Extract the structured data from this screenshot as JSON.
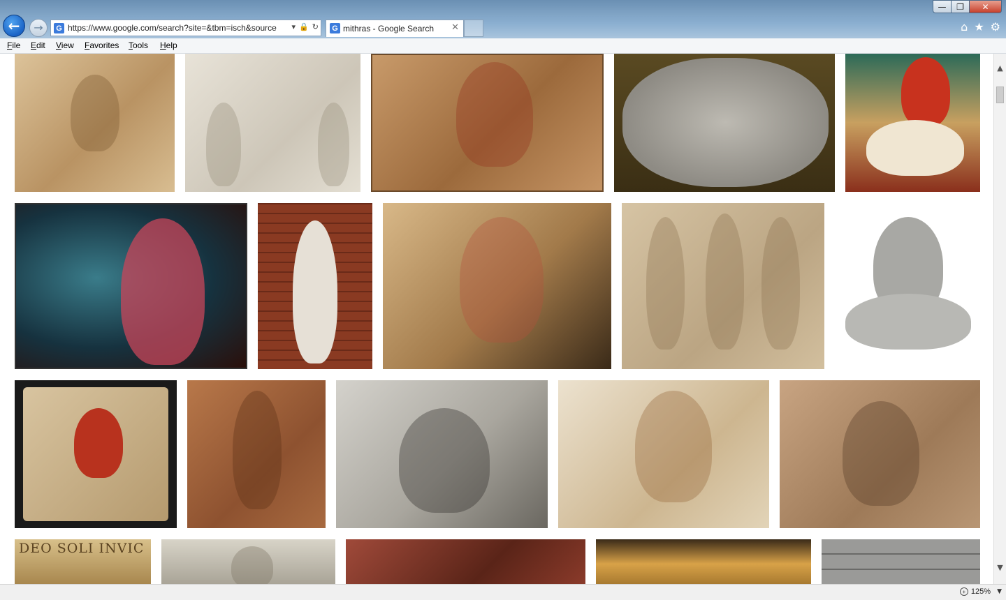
{
  "browser": {
    "address_url": "https://www.google.com/search?site=&tbm=isch&source",
    "tab_title": "mithras - Google Search",
    "tab_favicon": "G",
    "back_glyph": "←",
    "forward_glyph": "→",
    "tab_close_glyph": "✕",
    "window_controls": {
      "minimize": "—",
      "maximize": "❐",
      "close": "✕"
    },
    "toolbar_icons": {
      "home": "⌂",
      "favorites": "★",
      "settings": "⚙"
    }
  },
  "menu": {
    "items": [
      {
        "label": "File"
      },
      {
        "label": "Edit"
      },
      {
        "label": "View"
      },
      {
        "label": "Favorites"
      },
      {
        "label": "Tools"
      },
      {
        "label": "Help"
      }
    ]
  },
  "image_grid": {
    "rows": [
      [
        {
          "alt": "Mithras tauroctony relief, cream stone"
        },
        {
          "alt": "Mithras relief with torchbearers, white marble"
        },
        {
          "alt": "Mithras slaying bull, painted terracotta relief"
        },
        {
          "alt": "Mithras tauroctony sculpture, grey marble"
        },
        {
          "alt": "Mithras fresco, red cloak and white bull"
        }
      ],
      [
        {
          "alt": "Mithras fresco with starry blue cloak",
          "selected": true
        },
        {
          "alt": "Mithras rock-birth statue against brick wall"
        },
        {
          "alt": "Mithras tauroctony relief, painted stone"
        },
        {
          "alt": "Relief of standing figures with radiate crowns"
        },
        {
          "alt": "Mithras slaying bull, marble statue"
        }
      ],
      [
        {
          "alt": "Painted Mithras relief with Sol and Luna"
        },
        {
          "alt": "Mithras born from rock, sandstone relief"
        },
        {
          "alt": "Mithras tauroctony with zodiac figures, grey stone"
        },
        {
          "alt": "Mithras tauroctony with dog and serpent"
        },
        {
          "alt": "Mithras relief in cave arch, brown stone"
        }
      ],
      [
        {
          "alt": "Relief inscribed DEO SOLI INVICTO",
          "inscription": "DEO SOLI INVIC"
        },
        {
          "alt": "Relief with radiate bust of Sol"
        },
        {
          "alt": "Mithraeum wall painting, dark red"
        },
        {
          "alt": "Illuminated Mithras relief in museum niche"
        },
        {
          "alt": "Mithraic relief panels, grey stone"
        }
      ]
    ]
  },
  "status": {
    "zoom": "125%",
    "zoom_arrow": "▼"
  },
  "colors": {
    "titlebar": "#7fa3c4",
    "accent_back": "#1b64c6",
    "menubar": "#f4f6f8"
  }
}
